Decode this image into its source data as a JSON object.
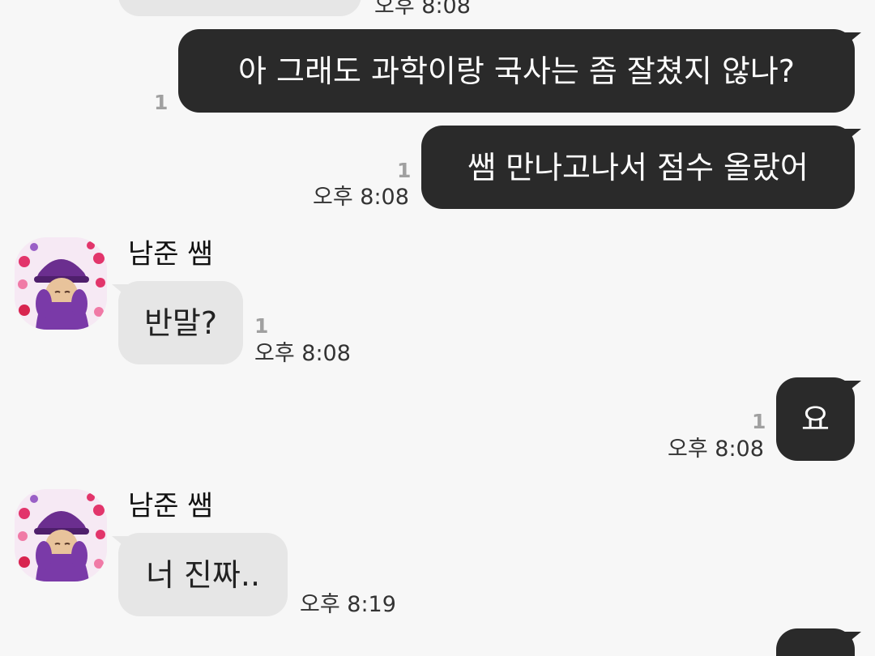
{
  "conversation": {
    "top_partial": {
      "time": "오후 8:08"
    },
    "messages": [
      {
        "text": "아 그래도 과학이랑 국사는 좀 잘쳤지 않나?",
        "unread": "1"
      },
      {
        "text": "쌤 만나고나서 점수 올랐어",
        "unread": "1",
        "time": "오후 8:08"
      },
      {
        "sender": "남준 쌤",
        "text": "반말?",
        "unread": "1",
        "time": "오후 8:08"
      },
      {
        "text": "요",
        "unread": "1",
        "time": "오후 8:08"
      },
      {
        "sender": "남준 쌤",
        "text": "너 진짜..",
        "time": "오후 8:19"
      }
    ]
  },
  "icons": {
    "avatar": "profile-photo-purple-cap-hearts"
  },
  "colors": {
    "background": "#f7f7f7",
    "outgoing_bubble": "#2a2a2a",
    "incoming_bubble": "#e6e6e6",
    "unread_count": "#a0a0a0"
  }
}
